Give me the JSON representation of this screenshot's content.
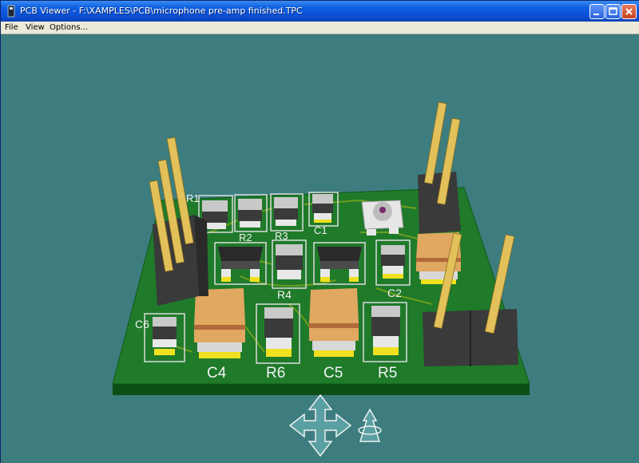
{
  "window": {
    "title": "PCB Viewer - F:\\XAMPLES\\PCB\\microphone pre-amp finished.TPC"
  },
  "menu": {
    "items": [
      {
        "label": "File"
      },
      {
        "label": "View"
      },
      {
        "label": "Options..."
      }
    ]
  },
  "board": {
    "designators": [
      "R1",
      "R2",
      "R3",
      "C1",
      "R4",
      "C2",
      "C6",
      "C4",
      "R6",
      "C5",
      "R5"
    ]
  },
  "colors": {
    "background": "#3d7d7f",
    "board": "#1f7a2a",
    "pin": "#e3c15a"
  },
  "controls": {
    "icons": [
      "pan-arrows-icon",
      "rotate-arrows-icon"
    ]
  }
}
